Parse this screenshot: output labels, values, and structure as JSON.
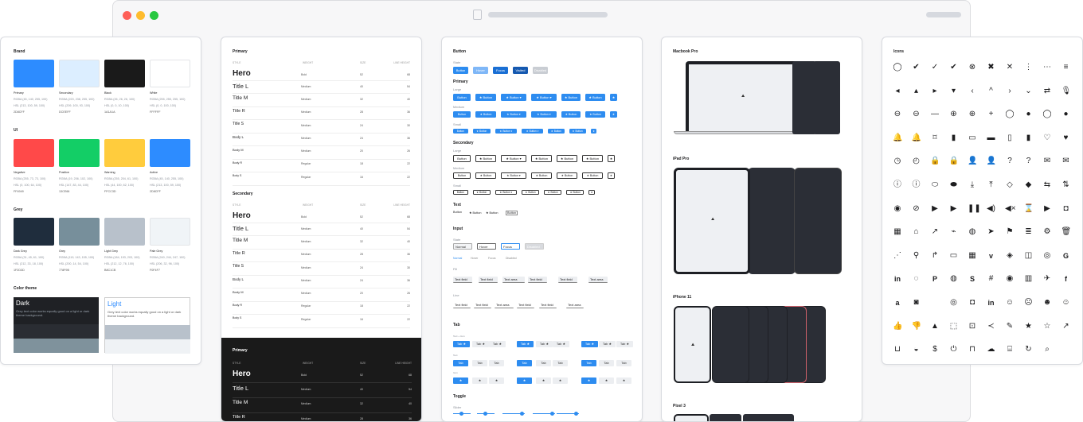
{
  "window": {
    "dots": [
      "#fe5f57",
      "#febc2e",
      "#28c840"
    ]
  },
  "colors": {
    "brand_title": "Brand",
    "brand": [
      {
        "name": "Primary",
        "rgba": "RGBA (45, 140, 255, 100)",
        "hsl": "HSL (213, 100, 59, 100)",
        "hex": "2D8CFF",
        "color": "#2d8cff"
      },
      {
        "name": "Secondary",
        "rgba": "RGBA (220, 238, 255, 100)",
        "hsl": "HSL (209, 100, 93, 100)",
        "hex": "DCEEFF",
        "color": "#dceeff"
      },
      {
        "name": "Black",
        "rgba": "RGBA (26, 26, 26, 100)",
        "hsl": "HSL (0, 0, 10, 100)",
        "hex": "1A1A1A",
        "color": "#1a1a1a"
      },
      {
        "name": "White",
        "rgba": "RGBA (255, 255, 255, 100)",
        "hsl": "HSL (0, 0, 100, 100)",
        "hex": "FFFFFF",
        "color": "#ffffff"
      }
    ],
    "ui_title": "UI",
    "ui": [
      {
        "name": "Negative",
        "rgba": "RGBA (255, 73, 73, 100)",
        "hsl": "HSL (0, 100, 64, 100)",
        "hex": "FF4949",
        "color": "#ff4949"
      },
      {
        "name": "Positive",
        "rgba": "RGBA (19, 206, 102, 100)",
        "hsl": "HSL (147, 83, 44, 100)",
        "hex": "13CE66",
        "color": "#13ce66"
      },
      {
        "name": "Warning",
        "rgba": "RGBA (255, 204, 61, 100)",
        "hsl": "HSL (44, 100, 62, 100)",
        "hex": "FFCC3D",
        "color": "#ffcc3d"
      },
      {
        "name": "Active",
        "rgba": "RGBA (45, 140, 255, 100)",
        "hsl": "HSL (213, 100, 59, 100)",
        "hex": "2D8CFF",
        "color": "#2d8cff"
      }
    ],
    "grey_title": "Grey",
    "grey": [
      {
        "name": "Dark Grey",
        "rgba": "RGBA (31, 45, 61, 100)",
        "hsl": "HSL (212, 33, 18, 100)",
        "hex": "1F2D3D",
        "color": "#1f2d3d"
      },
      {
        "name": "Grey",
        "rgba": "RGBA (119, 143, 155, 100)",
        "hsl": "HSL (200, 14, 54, 100)",
        "hex": "778F9B",
        "color": "#778f9b"
      },
      {
        "name": "Light Grey",
        "rgba": "RGBA (184, 193, 203, 100)",
        "hsl": "HSL (212, 12, 76, 100)",
        "hex": "B8C1CB",
        "color": "#b8c1cb"
      },
      {
        "name": "Pale Grey",
        "rgba": "RGBA (240, 244, 247, 100)",
        "hsl": "HSL (206, 32, 96, 100)",
        "hex": "F0F4F7",
        "color": "#f0f4f7"
      }
    ],
    "theme_title": "Color theme",
    "dark": {
      "title": "Dark",
      "desc": "Grey text color works equally good on a light or dark theme background."
    },
    "light": {
      "title": "Light",
      "desc": "Grey text color works equally good on a light or dark theme background."
    }
  },
  "type": {
    "primary_title": "Primary",
    "secondary_title": "Secondary",
    "headers": {
      "style": "STYLE",
      "weight": "WEIGHT",
      "size": "SIZE",
      "lh": "LINE HEIGHT"
    },
    "rows": [
      {
        "name": "Hero",
        "weight": "Bold",
        "size": "52",
        "lh": "68"
      },
      {
        "name": "Title L",
        "weight": "Medium",
        "size": "40",
        "lh": "54"
      },
      {
        "name": "Title M",
        "weight": "Medium",
        "size": "32",
        "lh": "40"
      },
      {
        "name": "Title R",
        "weight": "Medium",
        "size": "28",
        "lh": "36"
      },
      {
        "name": "Title S",
        "weight": "Medium",
        "size": "24",
        "lh": "30"
      },
      {
        "name": "Body L",
        "weight": "Medium",
        "size": "24",
        "lh": "36"
      },
      {
        "name": "Body M",
        "weight": "Medium",
        "size": "20",
        "lh": "26"
      },
      {
        "name": "Body R",
        "weight": "Regular",
        "size": "18",
        "lh": "22"
      },
      {
        "name": "Body S",
        "weight": "Regular",
        "size": "16",
        "lh": "22"
      }
    ]
  },
  "components": {
    "button_title": "Button",
    "state_label": "State",
    "states": [
      "Button",
      "Hover",
      "Focus",
      "Visited",
      "Disabled"
    ],
    "primary_label": "Primary",
    "secondary_label": "Secondary",
    "size_labels": [
      "Large",
      "Medium",
      "Small"
    ],
    "button_label": "Button",
    "text_label": "Text",
    "input_title": "Input",
    "input_states": [
      "Normal",
      "Hover",
      "Focus",
      "Disabled"
    ],
    "field_label": "Text field",
    "area_label": "Text area",
    "fill_label": "Fill",
    "line_label": "Line",
    "tab_title": "Tab",
    "tab_label": "Tab",
    "tab_groups": [
      "Text + Icon",
      "Text",
      "Icon"
    ],
    "toggle_title": "Toggle",
    "slider_label": "Slider"
  },
  "devices": {
    "macbook": "Macbook Pro",
    "ipad": "iPad Pro",
    "iphone": "iPhone 11",
    "pixel": "Pixel 3"
  },
  "icons": {
    "title": "Icons",
    "names": [
      "check-circle-icon",
      "check-circle-filled-icon",
      "check-icon",
      "double-check-icon",
      "close-circle-icon",
      "close-circle-filled-icon",
      "close-icon",
      "more-vertical-icon",
      "more-horizontal-icon",
      "menu-icon",
      "caret-left-icon",
      "caret-up-icon",
      "caret-right-icon",
      "caret-down-icon",
      "chevron-left-icon",
      "chevron-up-icon",
      "chevron-right-icon",
      "chevron-down-icon",
      "refresh-icon",
      "mic-icon",
      "minus-circle-icon",
      "minus-circle-filled-icon",
      "minus-icon",
      "plus-circle-icon",
      "plus-circle-filled-icon",
      "plus-icon",
      "chat-icon",
      "chat-filled-icon",
      "message-icon",
      "message-filled-icon",
      "bell-icon",
      "bell-filled-icon",
      "bookmark-icon",
      "bookmark-filled-icon",
      "folder-icon",
      "folder-filled-icon",
      "file-icon",
      "file-filled-icon",
      "heart-icon",
      "heart-filled-icon",
      "clock-icon",
      "clock-filled-icon",
      "lock-icon",
      "lock-filled-icon",
      "user-icon",
      "user-filled-icon",
      "help-icon",
      "help-filled-icon",
      "mail-icon",
      "mail-filled-icon",
      "info-icon",
      "info-filled-icon",
      "tag-icon",
      "tag-filled-icon",
      "download-icon",
      "upload-icon",
      "diamond-icon",
      "diamond-filled-icon",
      "swap-icon",
      "sort-icon",
      "eye-icon",
      "eye-off-icon",
      "play-circle-icon",
      "play-icon",
      "pause-icon",
      "volume-icon",
      "mute-icon",
      "hourglass-icon",
      "video-icon",
      "camera-icon",
      "grid-icon",
      "home-icon",
      "link-icon",
      "attachment-icon",
      "globe-icon",
      "send-icon",
      "flag-icon",
      "filter-icon",
      "settings-icon",
      "trash-icon",
      "loader-icon",
      "location-icon",
      "share-arrow-icon",
      "briefcase-icon",
      "calendar-icon",
      "vimeo-icon",
      "dropbox-icon",
      "copy-icon",
      "github-icon",
      "google-icon",
      "linkedin-icon",
      "messenger-icon",
      "pinterest-icon",
      "reddit-icon",
      "skype-icon",
      "slack-icon",
      "spotify-icon",
      "trello-icon",
      "twitter-icon",
      "facebook-icon",
      "amazon-icon",
      "android-icon",
      "apple-icon",
      "dribbble-icon",
      "instagram-icon",
      "linkedin-square-icon",
      "smile-icon",
      "frown-icon",
      "laugh-icon",
      "happy-icon",
      "thumbs-up-icon",
      "thumbs-down-icon",
      "image-icon",
      "scan-icon",
      "crop-icon",
      "share-icon",
      "pencil-icon",
      "star-icon",
      "star-half-icon",
      "arrow-icon",
      "basket-icon",
      "palette-icon",
      "dollar-icon",
      "power-icon",
      "inbox-icon",
      "cloud-icon",
      "box-icon",
      "reload-icon",
      "search-icon"
    ],
    "glyphs": [
      "◯",
      "✔",
      "✓",
      "✔",
      "⊗",
      "✖",
      "✕",
      "⋮",
      "⋯",
      "≡",
      "◂",
      "▴",
      "▸",
      "▾",
      "‹",
      "^",
      "›",
      "⌄",
      "⇄",
      "🎙",
      "⊖",
      "⊖",
      "—",
      "⊕",
      "⊕",
      "+",
      "◯",
      "●",
      "◯",
      "●",
      "🔔",
      "🔔",
      "⌑",
      "▮",
      "▭",
      "▬",
      "▯",
      "▮",
      "♡",
      "♥",
      "◷",
      "◴",
      "🔒",
      "🔒",
      "👤",
      "👤",
      "?",
      "?",
      "✉",
      "✉",
      "ⓘ",
      "ⓘ",
      "⬭",
      "⬬",
      "⤓",
      "⤒",
      "◇",
      "◆",
      "⇆",
      "⇅",
      "◉",
      "⊘",
      "▶",
      "▶",
      "❚❚",
      "◀)",
      "◀×",
      "⌛",
      "▶",
      "◘",
      "▦",
      "⌂",
      "↗",
      "⌁",
      "◍",
      "➤",
      "⚑",
      "≣",
      "⚙",
      "🗑",
      "⋰",
      "⚲",
      "↱",
      "▭",
      "▦",
      "v",
      "◈",
      "◫",
      "◎",
      "G",
      "in",
      "◌",
      "P",
      "◍",
      "S",
      "#",
      "◉",
      "▥",
      "✈",
      "f",
      "a",
      "◙",
      "",
      "◎",
      "◘",
      "in",
      "☺",
      "☹",
      "☻",
      "☺",
      "👍",
      "👎",
      "▲",
      "⬚",
      "⊡",
      "≺",
      "✎",
      "★",
      "☆",
      "↗",
      "⊔",
      "◒",
      "$",
      "⏻",
      "⊓",
      "☁",
      "⌸",
      "↻",
      "⌕"
    ]
  }
}
